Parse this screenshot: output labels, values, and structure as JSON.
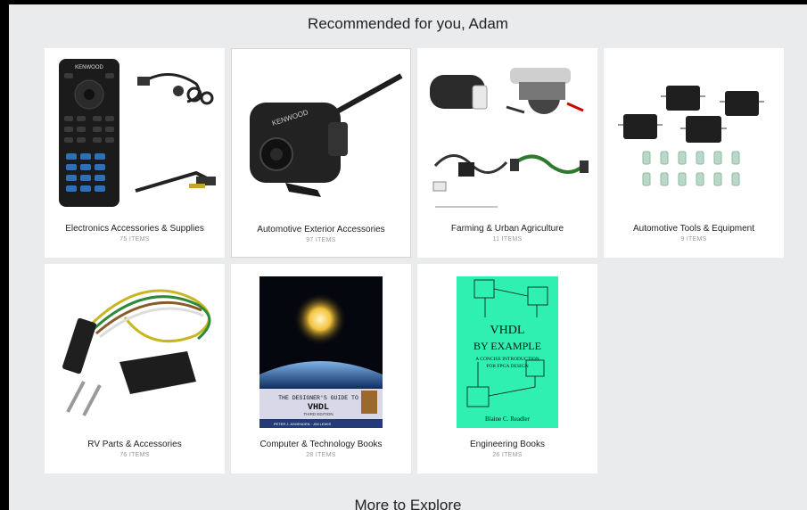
{
  "page": {
    "title": "Recommended for you, Adam",
    "more_heading": "More to Explore"
  },
  "categories": [
    {
      "name": "Electronics Accessories & Supplies",
      "count": "75 ITEMS",
      "image": "kenwood-remote-and-cables"
    },
    {
      "name": "Automotive Exterior Accessories",
      "count": "97 ITEMS",
      "image": "kenwood-backup-camera"
    },
    {
      "name": "Farming & Urban Agriculture",
      "count": "11 ITEMS",
      "image": "compressor-and-wiring-harness"
    },
    {
      "name": "Automotive Tools & Equipment",
      "count": "9 ITEMS",
      "image": "black-modules-and-connectors"
    },
    {
      "name": "RV Parts & Accessories",
      "count": "76 ITEMS",
      "image": "trailer-wiring-connector"
    },
    {
      "name": "Computer & Technology Books",
      "count": "28 ITEMS",
      "image": "vhdl-designers-guide-book",
      "book": {
        "line1": "THE DESIGNER'S GUIDE TO",
        "line2": "VHDL",
        "line3": "THIRD EDITION",
        "authors": "PETER J. ASHENDEN · JIM LEWIS"
      }
    },
    {
      "name": "Engineering Books",
      "count": "26 ITEMS",
      "image": "vhdl-by-example-book",
      "book": {
        "line1": "VHDL",
        "line2": "BY EXAMPLE",
        "line3": "A CONCISE INTRODUCTION",
        "line4": "FOR FPGA DESIGN",
        "author": "Blaine C. Readler"
      }
    }
  ],
  "brand_marks": {
    "remote": "KENWOOD",
    "camera": "KENWOOD"
  },
  "colors": {
    "page_bg": "#e9ebec",
    "card_bg": "#ffffff",
    "book_green": "#2ff0b0"
  }
}
